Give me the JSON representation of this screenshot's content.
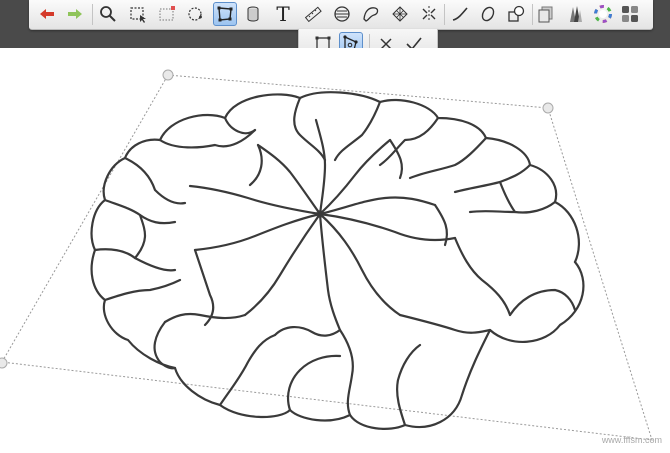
{
  "toolbar": {
    "tools": [
      {
        "name": "undo-icon"
      },
      {
        "name": "redo-icon"
      },
      {
        "name": "zoom-icon"
      },
      {
        "name": "selection-icon"
      },
      {
        "name": "crop-icon"
      },
      {
        "name": "lasso-move-icon"
      },
      {
        "name": "transform-icon",
        "active": true
      },
      {
        "name": "cylinder-icon"
      },
      {
        "name": "text-icon"
      },
      {
        "name": "ruler-icon"
      },
      {
        "name": "ellipse-guide-icon"
      },
      {
        "name": "french-curve-icon"
      },
      {
        "name": "perspective-grid-icon"
      },
      {
        "name": "symmetry-icon"
      },
      {
        "name": "stroke-icon"
      },
      {
        "name": "shape-icon"
      },
      {
        "name": "layers-shape-icon"
      },
      {
        "name": "layers-icon"
      },
      {
        "name": "brushes-icon"
      },
      {
        "name": "color-wheel-icon"
      },
      {
        "name": "swatches-icon"
      }
    ],
    "text_tool_glyph": "T"
  },
  "transform_options": {
    "modes": [
      {
        "name": "free-transform-icon",
        "active": false
      },
      {
        "name": "distort-icon",
        "active": true
      }
    ]
  },
  "colors": {
    "accent": "#9cc4f0",
    "undo": "#d43a2a",
    "redo": "#8fc45a",
    "stroke": "#3a3a3a"
  },
  "watermark": "www.fffsm.com"
}
